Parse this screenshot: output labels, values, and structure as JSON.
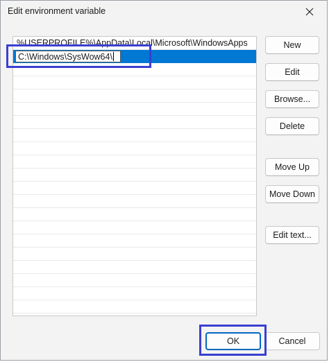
{
  "window": {
    "title": "Edit environment variable",
    "close_icon": "close-icon"
  },
  "list": {
    "items": [
      "%USERPROFILE%\\AppData\\Local\\Microsoft\\WindowsApps",
      "C:\\Windows\\SysWow64\\"
    ],
    "selected_index": 1,
    "editing_value": "C:\\Windows\\SysWow64\\"
  },
  "buttons": {
    "new": "New",
    "edit": "Edit",
    "browse": "Browse...",
    "delete": "Delete",
    "move_up": "Move Up",
    "move_down": "Move Down",
    "edit_text": "Edit text...",
    "ok": "OK",
    "cancel": "Cancel"
  },
  "colors": {
    "selection": "#0078d4",
    "highlight_annotation": "#3a3fd0",
    "default_button_border": "#0067c0"
  }
}
